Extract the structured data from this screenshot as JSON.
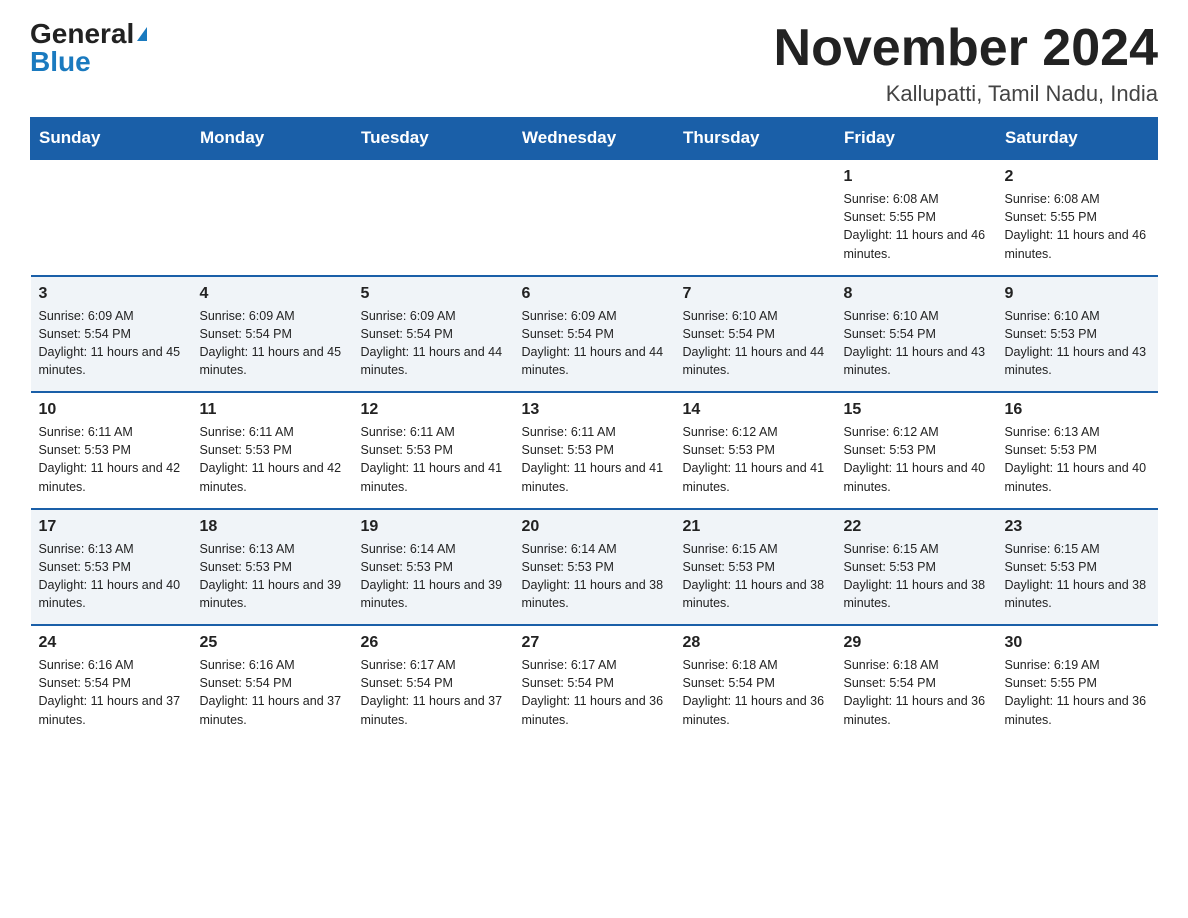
{
  "header": {
    "logo_general": "General",
    "logo_blue": "Blue",
    "month_title": "November 2024",
    "location": "Kallupatti, Tamil Nadu, India"
  },
  "days_of_week": [
    "Sunday",
    "Monday",
    "Tuesday",
    "Wednesday",
    "Thursday",
    "Friday",
    "Saturday"
  ],
  "weeks": [
    [
      {
        "day": "",
        "info": ""
      },
      {
        "day": "",
        "info": ""
      },
      {
        "day": "",
        "info": ""
      },
      {
        "day": "",
        "info": ""
      },
      {
        "day": "",
        "info": ""
      },
      {
        "day": "1",
        "info": "Sunrise: 6:08 AM\nSunset: 5:55 PM\nDaylight: 11 hours and 46 minutes."
      },
      {
        "day": "2",
        "info": "Sunrise: 6:08 AM\nSunset: 5:55 PM\nDaylight: 11 hours and 46 minutes."
      }
    ],
    [
      {
        "day": "3",
        "info": "Sunrise: 6:09 AM\nSunset: 5:54 PM\nDaylight: 11 hours and 45 minutes."
      },
      {
        "day": "4",
        "info": "Sunrise: 6:09 AM\nSunset: 5:54 PM\nDaylight: 11 hours and 45 minutes."
      },
      {
        "day": "5",
        "info": "Sunrise: 6:09 AM\nSunset: 5:54 PM\nDaylight: 11 hours and 44 minutes."
      },
      {
        "day": "6",
        "info": "Sunrise: 6:09 AM\nSunset: 5:54 PM\nDaylight: 11 hours and 44 minutes."
      },
      {
        "day": "7",
        "info": "Sunrise: 6:10 AM\nSunset: 5:54 PM\nDaylight: 11 hours and 44 minutes."
      },
      {
        "day": "8",
        "info": "Sunrise: 6:10 AM\nSunset: 5:54 PM\nDaylight: 11 hours and 43 minutes."
      },
      {
        "day": "9",
        "info": "Sunrise: 6:10 AM\nSunset: 5:53 PM\nDaylight: 11 hours and 43 minutes."
      }
    ],
    [
      {
        "day": "10",
        "info": "Sunrise: 6:11 AM\nSunset: 5:53 PM\nDaylight: 11 hours and 42 minutes."
      },
      {
        "day": "11",
        "info": "Sunrise: 6:11 AM\nSunset: 5:53 PM\nDaylight: 11 hours and 42 minutes."
      },
      {
        "day": "12",
        "info": "Sunrise: 6:11 AM\nSunset: 5:53 PM\nDaylight: 11 hours and 41 minutes."
      },
      {
        "day": "13",
        "info": "Sunrise: 6:11 AM\nSunset: 5:53 PM\nDaylight: 11 hours and 41 minutes."
      },
      {
        "day": "14",
        "info": "Sunrise: 6:12 AM\nSunset: 5:53 PM\nDaylight: 11 hours and 41 minutes."
      },
      {
        "day": "15",
        "info": "Sunrise: 6:12 AM\nSunset: 5:53 PM\nDaylight: 11 hours and 40 minutes."
      },
      {
        "day": "16",
        "info": "Sunrise: 6:13 AM\nSunset: 5:53 PM\nDaylight: 11 hours and 40 minutes."
      }
    ],
    [
      {
        "day": "17",
        "info": "Sunrise: 6:13 AM\nSunset: 5:53 PM\nDaylight: 11 hours and 40 minutes."
      },
      {
        "day": "18",
        "info": "Sunrise: 6:13 AM\nSunset: 5:53 PM\nDaylight: 11 hours and 39 minutes."
      },
      {
        "day": "19",
        "info": "Sunrise: 6:14 AM\nSunset: 5:53 PM\nDaylight: 11 hours and 39 minutes."
      },
      {
        "day": "20",
        "info": "Sunrise: 6:14 AM\nSunset: 5:53 PM\nDaylight: 11 hours and 38 minutes."
      },
      {
        "day": "21",
        "info": "Sunrise: 6:15 AM\nSunset: 5:53 PM\nDaylight: 11 hours and 38 minutes."
      },
      {
        "day": "22",
        "info": "Sunrise: 6:15 AM\nSunset: 5:53 PM\nDaylight: 11 hours and 38 minutes."
      },
      {
        "day": "23",
        "info": "Sunrise: 6:15 AM\nSunset: 5:53 PM\nDaylight: 11 hours and 38 minutes."
      }
    ],
    [
      {
        "day": "24",
        "info": "Sunrise: 6:16 AM\nSunset: 5:54 PM\nDaylight: 11 hours and 37 minutes."
      },
      {
        "day": "25",
        "info": "Sunrise: 6:16 AM\nSunset: 5:54 PM\nDaylight: 11 hours and 37 minutes."
      },
      {
        "day": "26",
        "info": "Sunrise: 6:17 AM\nSunset: 5:54 PM\nDaylight: 11 hours and 37 minutes."
      },
      {
        "day": "27",
        "info": "Sunrise: 6:17 AM\nSunset: 5:54 PM\nDaylight: 11 hours and 36 minutes."
      },
      {
        "day": "28",
        "info": "Sunrise: 6:18 AM\nSunset: 5:54 PM\nDaylight: 11 hours and 36 minutes."
      },
      {
        "day": "29",
        "info": "Sunrise: 6:18 AM\nSunset: 5:54 PM\nDaylight: 11 hours and 36 minutes."
      },
      {
        "day": "30",
        "info": "Sunrise: 6:19 AM\nSunset: 5:55 PM\nDaylight: 11 hours and 36 minutes."
      }
    ]
  ]
}
